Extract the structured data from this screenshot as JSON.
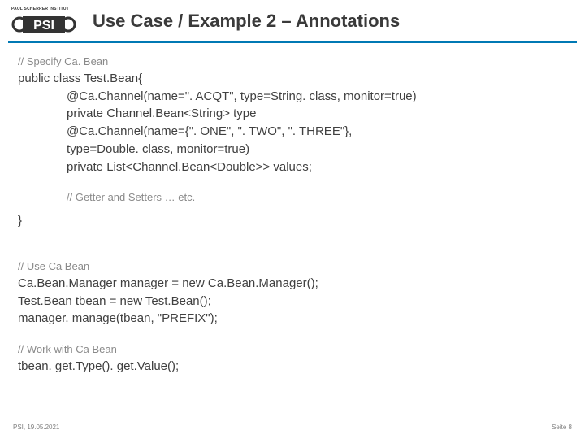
{
  "logo": {
    "top_text": "PAUL SCHERRER INSTITUT",
    "mark_text": "PSI"
  },
  "title": "Use Case / Example 2 – Annotations",
  "sections": {
    "s1": {
      "comment": "// Specify Ca. Bean",
      "l1": "public class Test.Bean{",
      "l2": "@Ca.Channel(name=\". ACQT\", type=String. class, monitor=true)",
      "l3": "private Channel.Bean<String> type",
      "l4": "@Ca.Channel(name={\". ONE\", \". TWO\", \". THREE\"},",
      "l5": "type=Double. class, monitor=true)",
      "l6": "private List<Channel.Bean<Double>> values;",
      "l7": "// Getter and Setters … etc.",
      "l8": "}"
    },
    "s2": {
      "comment": "// Use Ca Bean",
      "l1": "Ca.Bean.Manager manager = new Ca.Bean.Manager();",
      "l2": "Test.Bean tbean = new Test.Bean();",
      "l3": "manager. manage(tbean, \"PREFIX\");"
    },
    "s3": {
      "comment": "// Work with Ca Bean",
      "l1": "tbean. get.Type(). get.Value();"
    }
  },
  "footer": {
    "left": "PSI, 19.05.2021",
    "right": "Seite 8"
  }
}
